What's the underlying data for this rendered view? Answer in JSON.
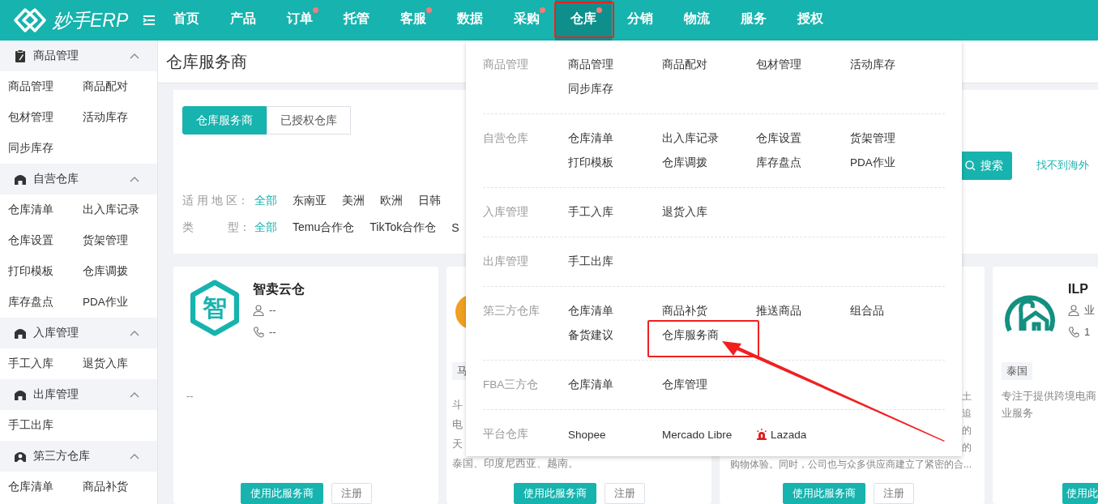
{
  "logo": {
    "text": "妙手ERP"
  },
  "nav": [
    {
      "label": "首页",
      "selected": false,
      "dot": false
    },
    {
      "label": "产品",
      "selected": false,
      "dot": false
    },
    {
      "label": "订单",
      "selected": false,
      "dot": true
    },
    {
      "label": "托管",
      "selected": false,
      "dot": false
    },
    {
      "label": "客服",
      "selected": false,
      "dot": true
    },
    {
      "label": "数据",
      "selected": false,
      "dot": false
    },
    {
      "label": "采购",
      "selected": false,
      "dot": true
    },
    {
      "label": "仓库",
      "selected": true,
      "dot": true,
      "annotated": true
    },
    {
      "label": "分销",
      "selected": false,
      "dot": false
    },
    {
      "label": "物流",
      "selected": false,
      "dot": false
    },
    {
      "label": "服务",
      "selected": false,
      "dot": false
    },
    {
      "label": "授权",
      "selected": false,
      "dot": false
    }
  ],
  "sidebar": [
    {
      "title": "商品管理",
      "expanded": true,
      "items": [
        "商品管理",
        "商品配对",
        "包材管理",
        "活动库存",
        "同步库存"
      ]
    },
    {
      "title": "自营仓库",
      "expanded": true,
      "items": [
        "仓库清单",
        "出入库记录",
        "仓库设置",
        "货架管理",
        "打印模板",
        "仓库调拨",
        "库存盘点",
        "PDA作业"
      ]
    },
    {
      "title": "入库管理",
      "expanded": true,
      "items": [
        "手工入库",
        "退货入库"
      ]
    },
    {
      "title": "出库管理",
      "expanded": true,
      "items": [
        "手工出库"
      ]
    },
    {
      "title": "第三方仓库",
      "expanded": true,
      "items": [
        "仓库清单",
        "商品补货"
      ]
    }
  ],
  "page_title": "仓库服务商",
  "tabs": [
    {
      "label": "仓库服务商",
      "selected": true
    },
    {
      "label": "已授权仓库",
      "selected": false
    }
  ],
  "search_button": "搜索",
  "help_link": "找不到海外",
  "filters": [
    {
      "label": "适 用 地 区：",
      "options": [
        {
          "label": "全部",
          "selected": true
        },
        {
          "label": "东南亚",
          "selected": false
        },
        {
          "label": "美洲",
          "selected": false
        },
        {
          "label": "欧洲",
          "selected": false
        },
        {
          "label": "日韩",
          "selected": false
        }
      ]
    },
    {
      "label": "类　　　型：",
      "options": [
        {
          "label": "全部",
          "selected": true
        },
        {
          "label": "Temu合作仓",
          "selected": false
        },
        {
          "label": "TikTok合作仓",
          "selected": false
        },
        {
          "label": "S",
          "selected": false
        }
      ]
    }
  ],
  "cards": [
    {
      "logo_text": "智",
      "name": "智卖云仓",
      "contact": "--",
      "phone": "--",
      "desc_lines": [
        "--"
      ],
      "buttons": [
        {
          "label": "使用此服务商",
          "kind": "primary"
        },
        {
          "label": "注册",
          "kind": "plain"
        }
      ]
    },
    {
      "tags": [
        "马"
      ],
      "desc_lines": [
        "斗",
        "电",
        "天",
        "泰国、印度尼西亚、越南。"
      ],
      "buttons": [
        {
          "label": "使用此服务商",
          "kind": "primary"
        },
        {
          "label": "注册",
          "kind": "plain"
        }
      ]
    },
    {
      "desc_lines": [
        "土",
        "追",
        "的",
        "的",
        "购物体验。同时，公司也与众多供应商建立了紧密的合..."
      ],
      "buttons": [
        {
          "label": "使用此服务商",
          "kind": "primary"
        },
        {
          "label": "注册",
          "kind": "plain"
        }
      ]
    },
    {
      "name": "ILP",
      "contact": "业",
      "phone": "1",
      "tags": [
        "泰国"
      ],
      "desc_lines": [
        "专注于提供跨境电商",
        "业服务"
      ],
      "buttons": [
        {
          "label": "使用此",
          "kind": "primary"
        }
      ]
    }
  ],
  "menu": {
    "groups": [
      {
        "label": "商品管理",
        "items": [
          {
            "label": "商品管理"
          },
          {
            "label": "商品配对"
          },
          {
            "label": "包材管理"
          },
          {
            "label": "活动库存"
          },
          {
            "label": "同步库存"
          }
        ]
      },
      {
        "label": "自营仓库",
        "items": [
          {
            "label": "仓库清单"
          },
          {
            "label": "出入库记录"
          },
          {
            "label": "仓库设置"
          },
          {
            "label": "货架管理"
          },
          {
            "label": "打印模板"
          },
          {
            "label": "仓库调拨"
          },
          {
            "label": "库存盘点"
          },
          {
            "label": "PDA作业"
          }
        ]
      },
      {
        "label": "入库管理",
        "items": [
          {
            "label": "手工入库"
          },
          {
            "label": "退货入库"
          }
        ]
      },
      {
        "label": "出库管理",
        "items": [
          {
            "label": "手工出库"
          }
        ]
      },
      {
        "label": "第三方仓库",
        "items": [
          {
            "label": "仓库清单"
          },
          {
            "label": "商品补货"
          },
          {
            "label": "推送商品"
          },
          {
            "label": "组合品"
          },
          {
            "label": "备货建议"
          },
          {
            "label": "仓库服务商",
            "annotated": true
          }
        ]
      },
      {
        "label": "FBA三方仓",
        "items": [
          {
            "label": "仓库清单"
          },
          {
            "label": "仓库管理"
          }
        ]
      },
      {
        "label": "平台仓库",
        "items": [
          {
            "label": "Shopee",
            "kind": "plain"
          },
          {
            "label": "Mercado Libre",
            "kind": "plain"
          },
          {
            "label": "Lazada",
            "kind": "alert"
          }
        ]
      }
    ]
  }
}
